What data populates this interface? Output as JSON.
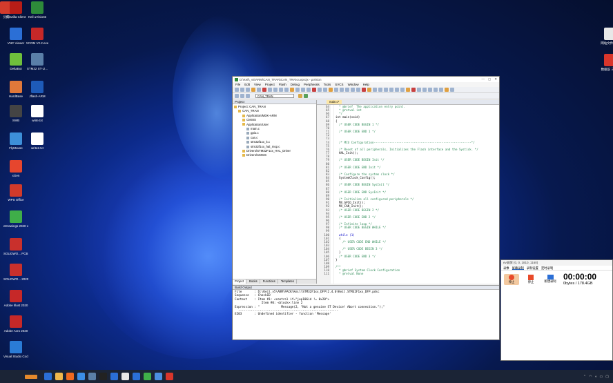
{
  "desktop": {
    "icons": [
      {
        "label": "分支",
        "color": "#d23b2c"
      },
      {
        "label": "FileZilla Client",
        "color": "#b81d17"
      },
      {
        "label": "Keil uVision5",
        "color": "#2e8b3a"
      },
      {
        "label": "VNC Viewer",
        "color": "#2b6fd6"
      },
      {
        "label": "XCOM V2.2.exe",
        "color": "#c62828"
      },
      {
        "label": "DeltaBot",
        "color": "#6fbf3c"
      },
      {
        "label": "STM32 ST-LI...",
        "color": "#5a7fa8"
      },
      {
        "label": "HardBase",
        "color": "#e0783a"
      },
      {
        "label": "Jflash-ARM",
        "color": "#1e5bb8"
      },
      {
        "label": "SWB",
        "color": "#444"
      },
      {
        "label": "write.txt",
        "color": "#ffffff"
      },
      {
        "label": "FlyMouse",
        "color": "#3d8fd8"
      },
      {
        "label": "write2.txt",
        "color": "#ffffff"
      },
      {
        "label": "xGen",
        "color": "#e6462e"
      },
      {
        "label": "WPS Office",
        "color": "#d13a2b"
      },
      {
        "label": "eDrawings 2020 x6...",
        "color": "#3fae49"
      },
      {
        "label": "SOLIDWO... PCB 2020",
        "color": "#c9302c"
      },
      {
        "label": "SOLIDWO... 2020",
        "color": "#c9302c"
      },
      {
        "label": "Adobe Illust 2020",
        "color": "#c62828"
      },
      {
        "label": "Adobe Acro 2020",
        "color": "#c62828"
      },
      {
        "label": "Visual Studio Code",
        "color": "#2a7bd6"
      }
    ],
    "right_icons": [
      {
        "label": "网站文件 who",
        "color": "#e8e8e8"
      },
      {
        "label": "数据说 三.pdf",
        "color": "#d9362b"
      }
    ]
  },
  "keil": {
    "title": "D:\\Keil\\_v5\\ARM\\CAN_TRAN\\CAN_TRAN.uvprojx - µVision",
    "menu": [
      "File",
      "Edit",
      "View",
      "Project",
      "Flash",
      "Debug",
      "Peripherals",
      "Tools",
      "SVCS",
      "Window",
      "Help"
    ],
    "target": "CAN_TRAN",
    "project_pane_title": "Project",
    "tree": [
      {
        "label": "Project: CAN_TRAN",
        "indent": 0
      },
      {
        "label": "CAN_TRAN",
        "indent": 1
      },
      {
        "label": "Application/MDK-ARM",
        "indent": 2
      },
      {
        "label": "CMSIS",
        "indent": 2
      },
      {
        "label": "Application/User",
        "indent": 2
      },
      {
        "label": "main.c",
        "indent": 3
      },
      {
        "label": "gpio.c",
        "indent": 3
      },
      {
        "label": "can.c",
        "indent": 3
      },
      {
        "label": "stm32f1xx_it.c",
        "indent": 3
      },
      {
        "label": "stm32f1xx_hal_msp.c",
        "indent": 3
      },
      {
        "label": "Drivers/STM32F1xx_HAL_Driver",
        "indent": 2
      },
      {
        "label": "Drivers/CMSIS",
        "indent": 2
      }
    ],
    "pane_tabs": [
      "Project",
      "Books",
      "Functions",
      "Templates"
    ],
    "editor_tab": "main.c*",
    "code_lines": [
      {
        "n": "64",
        "t": "  * @brief  The application entry point.",
        "c": "cm"
      },
      {
        "n": "65",
        "t": "  * @retval int",
        "c": "cm"
      },
      {
        "n": "66",
        "t": "  */",
        "c": "cm"
      },
      {
        "n": "67",
        "t": "int main(void)",
        "c": ""
      },
      {
        "n": "68",
        "t": "{",
        "c": ""
      },
      {
        "n": "69",
        "t": "  /* USER CODE BEGIN 1 */",
        "c": "cm"
      },
      {
        "n": "70",
        "t": "",
        "c": ""
      },
      {
        "n": "71",
        "t": "  /* USER CODE END 1 */",
        "c": "cm"
      },
      {
        "n": "72",
        "t": "",
        "c": ""
      },
      {
        "n": "73",
        "t": "",
        "c": ""
      },
      {
        "n": "74",
        "t": "  /* MCU Configuration--------------------------------------------------------*/",
        "c": "cm"
      },
      {
        "n": "75",
        "t": "",
        "c": ""
      },
      {
        "n": "76",
        "t": "  /* Reset of all peripherals, Initializes the Flash interface and the Systick. */",
        "c": "cm"
      },
      {
        "n": "77",
        "t": "  HAL_Init();",
        "c": ""
      },
      {
        "n": "78",
        "t": "",
        "c": ""
      },
      {
        "n": "79",
        "t": "  /* USER CODE BEGIN Init */",
        "c": "cm"
      },
      {
        "n": "80",
        "t": "",
        "c": ""
      },
      {
        "n": "81",
        "t": "  /* USER CODE END Init */",
        "c": "cm"
      },
      {
        "n": "82",
        "t": "",
        "c": ""
      },
      {
        "n": "83",
        "t": "  /* Configure the system clock */",
        "c": "cm"
      },
      {
        "n": "84",
        "t": "  SystemClock_Config();",
        "c": ""
      },
      {
        "n": "85",
        "t": "",
        "c": ""
      },
      {
        "n": "86",
        "t": "  /* USER CODE BEGIN SysInit */",
        "c": "cm"
      },
      {
        "n": "87",
        "t": "",
        "c": ""
      },
      {
        "n": "88",
        "t": "  /* USER CODE END SysInit */",
        "c": "cm"
      },
      {
        "n": "89",
        "t": "",
        "c": ""
      },
      {
        "n": "90",
        "t": "  /* Initialize all configured peripherals */",
        "c": "cm"
      },
      {
        "n": "91",
        "t": "  MX_GPIO_Init();",
        "c": ""
      },
      {
        "n": "92",
        "t": "  MX_CAN_Init();",
        "c": ""
      },
      {
        "n": "93",
        "t": "  /* USER CODE BEGIN 2 */",
        "c": "cm"
      },
      {
        "n": "94",
        "t": "",
        "c": ""
      },
      {
        "n": "95",
        "t": "  /* USER CODE END 2 */",
        "c": "cm"
      },
      {
        "n": "96",
        "t": "",
        "c": ""
      },
      {
        "n": "97",
        "t": "  /* Infinite loop */",
        "c": "cm"
      },
      {
        "n": "98",
        "t": "  /* USER CODE BEGIN WHILE */",
        "c": "cm"
      },
      {
        "n": "99",
        "t": "",
        "c": ""
      },
      {
        "n": "100",
        "t": "  while (1)",
        "c": "kw"
      },
      {
        "n": "101",
        "t": "  {",
        "c": ""
      },
      {
        "n": "102",
        "t": "    /* USER CODE END WHILE */",
        "c": "cm"
      },
      {
        "n": "103",
        "t": "",
        "c": ""
      },
      {
        "n": "104",
        "t": "    /* USER CODE BEGIN 3 */",
        "c": "cm"
      },
      {
        "n": "105",
        "t": "  }",
        "c": ""
      },
      {
        "n": "106",
        "t": "  /* USER CODE END 3 */",
        "c": "cm"
      },
      {
        "n": "107",
        "t": "}",
        "c": ""
      },
      {
        "n": "108",
        "t": "",
        "c": ""
      },
      {
        "n": "109",
        "t": "/**",
        "c": "cm"
      },
      {
        "n": "110",
        "t": "  * @brief System Clock Configuration",
        "c": "cm"
      },
      {
        "n": "111",
        "t": "  * @retval None",
        "c": "cm"
      }
    ],
    "build_title": "Build Output",
    "build_lines": [
      "File       : D:\\Keil_v5\\ARM\\PACK\\Keil\\STM32F1xx_DFP\\2.4.0\\Keil.STM32F1xx_DFP.pdsc",
      "Sequence   : CheckID",
      "Context    : Item #1: <control if=\"jep106id != 0x20\">",
      "               Item #0: <block>:line 2",
      "Expression : \"            Message(2, \"Not a genuine ST Device! Abort connection.\");\"",
      "  --------------------------------------------------------",
      "E203       : Undefined identifier - function 'Message'"
    ]
  },
  "recorder": {
    "title": "ev录屏 (0, 0, 1810, 1160)",
    "tabs": [
      "录像",
      "屏幕录制",
      "录制设置",
      "定时录制"
    ],
    "buttons": [
      "停止",
      "停止",
      "新建录制"
    ],
    "time": "00:00:00",
    "size": "0bytes / 178.4GB"
  },
  "taskbar": {
    "apps": [
      "#2b6fd6",
      "#f2b84b",
      "#f06a1f",
      "#3b8ee6",
      "#5a7fa8",
      "#222",
      "#2b6fd6",
      "#e8e8e8",
      "#2b6fd6",
      "#3fae49",
      "#4c8fe0",
      "#d9362b"
    ]
  }
}
